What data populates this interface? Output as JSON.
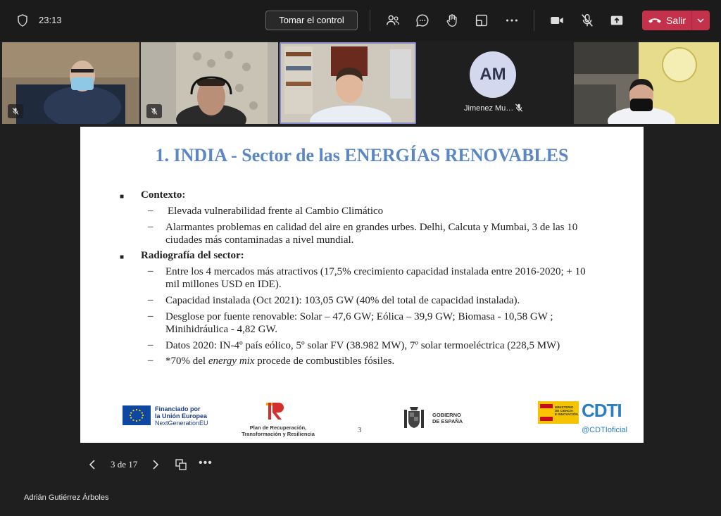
{
  "topbar": {
    "timer": "23:13",
    "take_control": "Tomar el control",
    "leave": "Salir",
    "icons": [
      "shield-icon",
      "people-icon",
      "chat-icon",
      "raise-hand-icon",
      "share-tray-icon",
      "more-icon",
      "camera-icon",
      "mic-off-icon",
      "share-icon",
      "phone-icon",
      "chevron-down-icon"
    ],
    "leave_color": "#c4314b"
  },
  "participants": {
    "avatar_initials": "AM",
    "avatar_name": "Jimenez Mu…"
  },
  "slide": {
    "title": "1. INDIA - Sector de las ENERGÍAS RENOVABLES",
    "bullet_glyph": "■",
    "dash_glyph": "–",
    "section1": {
      "heading": "Contexto:",
      "items": [
        "Elevada vulnerabilidad frente al Cambio Climático",
        "Alarmantes problemas en calidad del aire en grandes urbes. Delhi, Calcuta y Mumbai, 3 de las 10 ciudades más contaminadas a nivel mundial."
      ]
    },
    "section2": {
      "heading": "Radiografía del sector:",
      "items": [
        "Entre los 4 mercados más atractivos (17,5% crecimiento capacidad instalada entre 2016-2020; + 10 mil millones USD en IDE).",
        "Capacidad instalada (Oct 2021): 103,05 GW (40% del total de capacidad instalada).",
        "Desglose por fuente renovable: Solar – 47,6 GW; Eólica – 39,9 GW; Biomasa - 10,58 GW ; Minihidráulica - 4,82 GW.",
        "Datos 2020: IN-4º país eólico, 5º solar FV (38.982 MW), 7º solar termoeléctrica (228,5 MW)"
      ],
      "last_item": {
        "pre": "*70% del ",
        "em": "energy mix",
        "post": " procede de combustibles fósiles."
      }
    },
    "page_number": "3",
    "title_color": "#5b87c5",
    "logos": {
      "eu_line1": "Financiado por",
      "eu_line2": "la Unión Europea",
      "eu_line3": "NextGenerationEU",
      "plan_line1": "Plan de Recuperación,",
      "plan_line2": "Transformación y Resiliencia",
      "gob_line1": "GOBIERNO",
      "gob_line2": "DE ESPAÑA",
      "mincin_line1": "MINISTERIO",
      "mincin_line2": "DE CIENCIA",
      "mincin_line3": "E INNOVACIÓN",
      "cdti": "CDTI",
      "cdti_handle": "@CDTIoficial"
    }
  },
  "controls": {
    "page_indicator": "3 de 17",
    "more": "•••"
  },
  "presenter_name": "Adrián Gutiérrez Árboles"
}
